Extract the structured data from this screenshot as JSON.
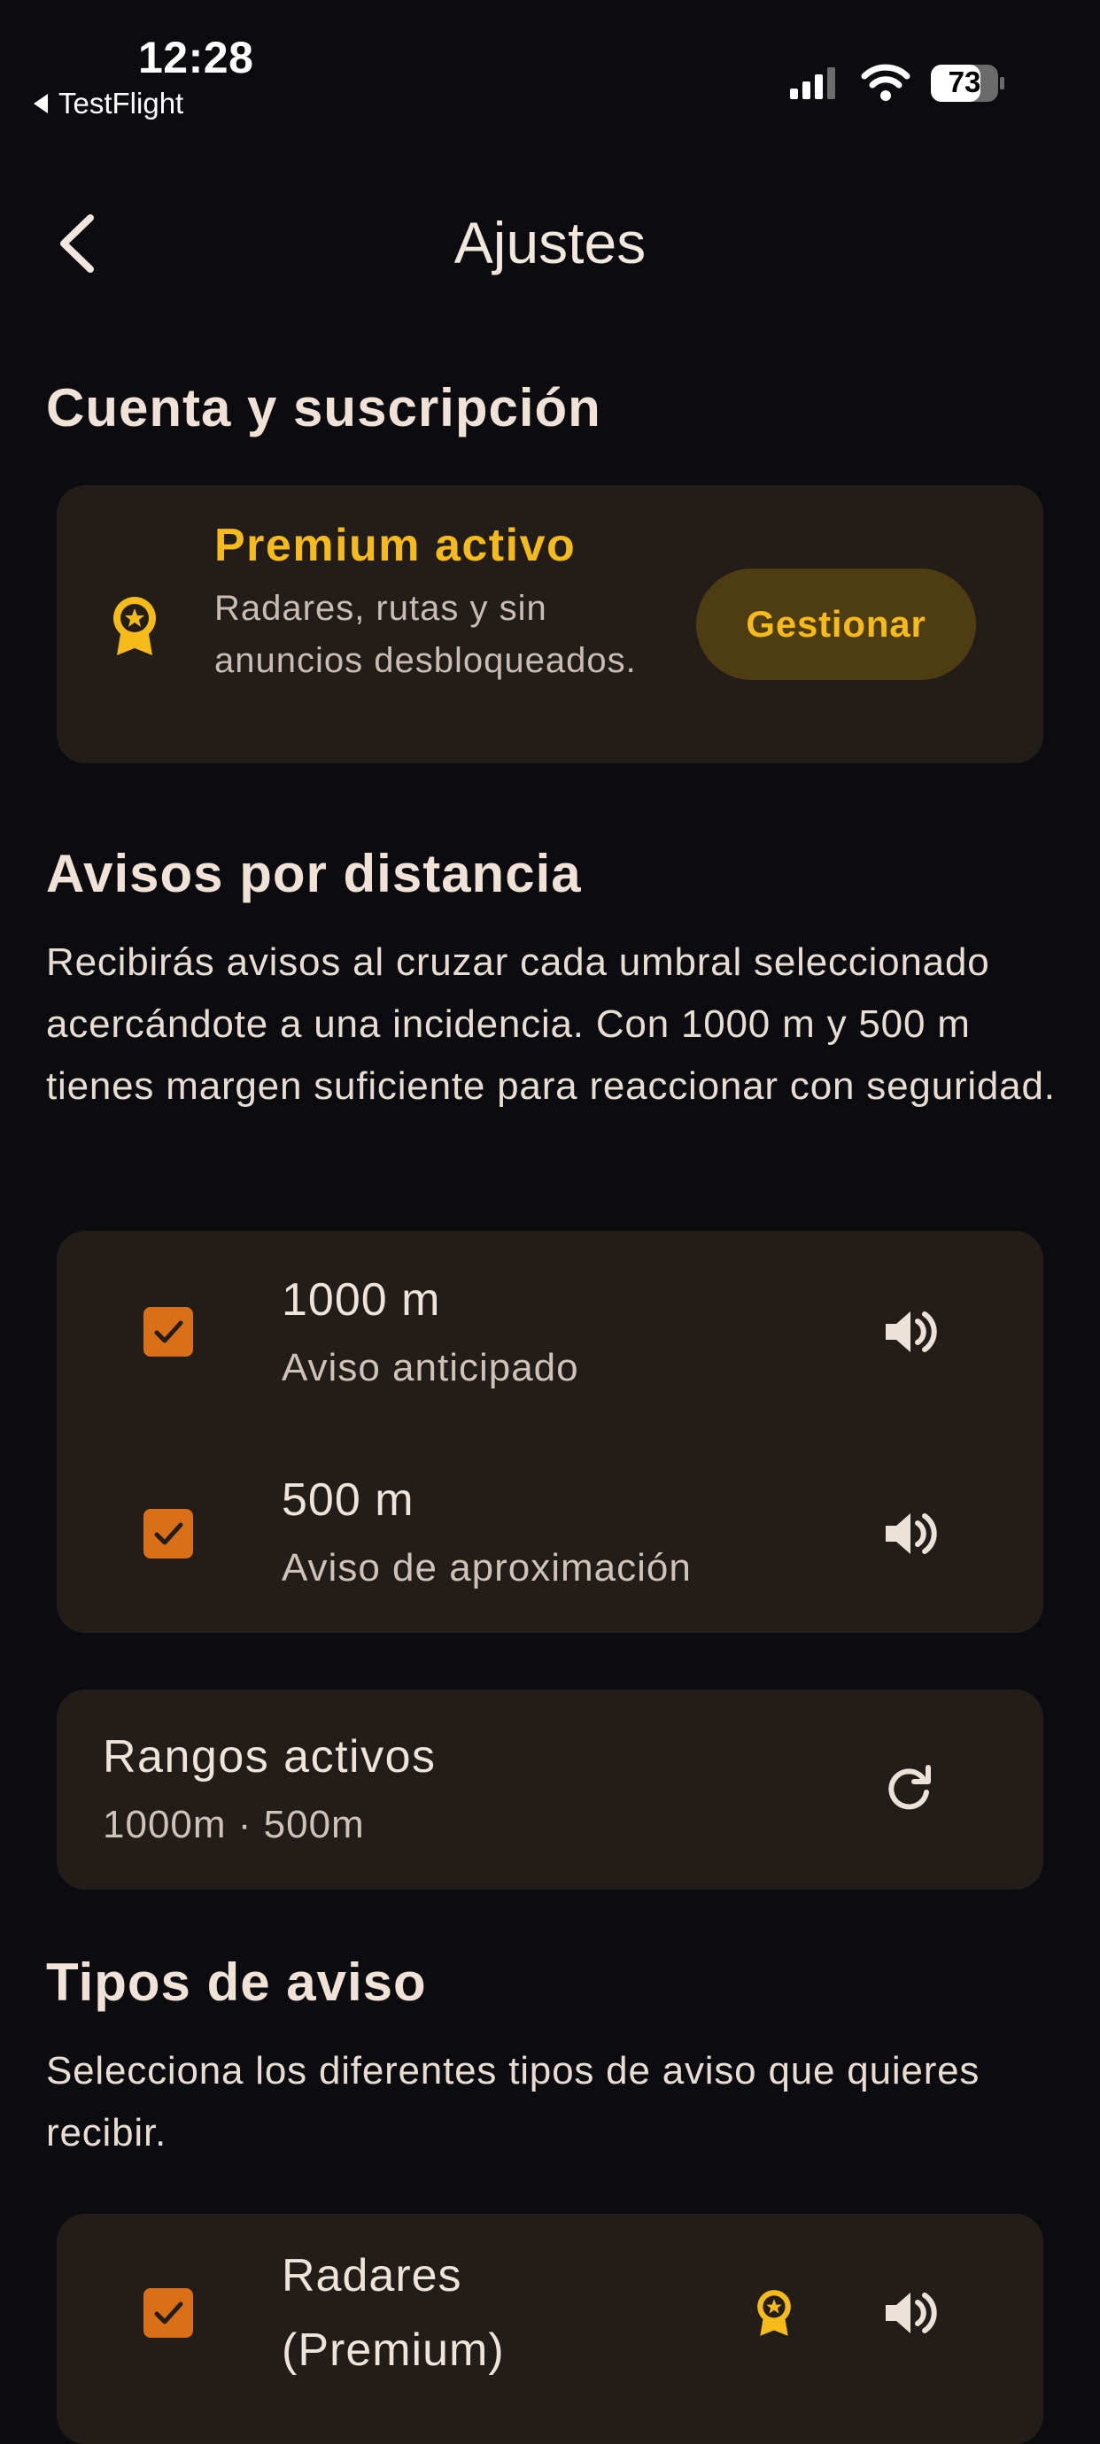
{
  "status_bar": {
    "time": "12:28",
    "back_app": "TestFlight",
    "battery": "73"
  },
  "nav": {
    "title": "Ajustes"
  },
  "account": {
    "section_title": "Cuenta y suscripción",
    "premium_title": "Premium activo",
    "premium_desc": "Radares, rutas y sin anuncios desbloqueados.",
    "manage_label": "Gestionar"
  },
  "distance": {
    "section_title": "Avisos por distancia",
    "description": "Recibirás avisos al cruzar cada umbral seleccionado acercándote a una incidencia. Con 1000 m y 500 m tienes margen suficiente para reaccionar con seguridad.",
    "items": [
      {
        "title": "1000 m",
        "subtitle": "Aviso anticipado",
        "checked": true
      },
      {
        "title": "500 m",
        "subtitle": "Aviso de aproximación",
        "checked": true
      }
    ],
    "ranges_title": "Rangos activos",
    "ranges_value": "1000m · 500m"
  },
  "types": {
    "section_title": "Tipos de aviso",
    "description": "Selecciona los diferentes tipos de aviso que quieres recibir.",
    "items": [
      {
        "title": "Radares",
        "subtitle": "(Premium)",
        "checked": true
      }
    ]
  },
  "colors": {
    "background": "#0c0c10",
    "card": "#231d1a",
    "accent_gold": "#f6ba19",
    "checkbox_orange": "#d96f16"
  },
  "icons": [
    "chevron-left-icon",
    "award-badge-icon",
    "speaker-icon",
    "refresh-icon",
    "check-icon"
  ]
}
